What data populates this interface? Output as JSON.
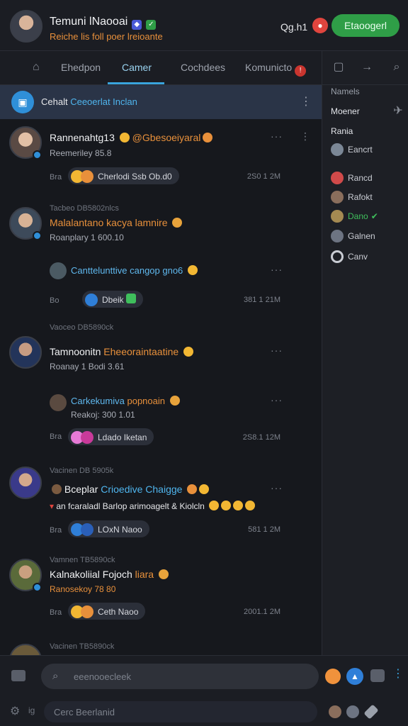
{
  "header": {
    "name": "Temuni lNaooai",
    "subtitle": "Reiche lis foll poer lreioante",
    "status": "Qg.h1",
    "cta_label": "Etaoogerl"
  },
  "tabs": [
    {
      "label": "Ehedpon"
    },
    {
      "label": "Camer"
    },
    {
      "label": "Cochdees"
    },
    {
      "label": "Komunicto"
    }
  ],
  "rail": {
    "items": [
      "Namels",
      "Moener",
      "Rania"
    ],
    "users": [
      "Eancrt",
      "Rancd",
      "Rafokt",
      "Dano",
      "Galnen",
      "Canv"
    ]
  },
  "pinned": {
    "text": "Cehalt",
    "highlight": "Ceeoerlat Inclan"
  },
  "posts": [
    {
      "meta": "",
      "title": "Rannenahtg13",
      "title_hl": "@Gbesoeiyaral",
      "sub": "Reemeriley 85.8",
      "footer": "Bra",
      "pill": "Cherlodi Ssb Ob.d0",
      "time": "2S0 1 2M"
    },
    {
      "meta": "Tacbeo DB5802nlcs",
      "title": "Malalantano kacya lamnire",
      "sub": "Roanplary 1 600.10",
      "nested": "Canttelunttive cangop gno6",
      "footer": "Bo",
      "pill": "Dbeik",
      "time": "381 1 21M"
    },
    {
      "meta": "Vaoceo DB5890ck",
      "title": "Tamnoonitn",
      "title_hl": "Eheeoraintaatine",
      "sub": "Roanay 1 Bodi 3.61",
      "nested": "Carkekumiva",
      "nested_hl": "popnoain",
      "nested_sub": "Reakoj: 300 1.01",
      "footer": "Bra",
      "pill": "Ldado Iketan",
      "time": "2S8.1 12M"
    },
    {
      "meta": "Vacinen DB 5905k",
      "title": "Bceplar",
      "title_hl": "Crioedive Chaigge",
      "sub": "an fcaraladl Barlop arimoagelt & Kiolcln",
      "footer": "Bra",
      "pill": "LOxN Naoo",
      "time": "581 1 2M"
    },
    {
      "meta": "Vamnen TB5890ck",
      "title": "Kalnakoliial Fojoch",
      "title_hl": "liara",
      "sub": "Ranosekoy 78 80",
      "footer": "Bra",
      "pill": "Ceth Naoo",
      "time": "2001.1 2M"
    },
    {
      "meta": "Vacinen TB5890ck"
    }
  ],
  "composer": {
    "placeholder": "eeenooecleek",
    "placeholder2": "Cerc Beerlanid",
    "lang": "ig"
  },
  "colors": {
    "accent": "#39a4dd",
    "cta": "#2f9e47",
    "highlight_orange": "#e8903b",
    "pinned_bg": "#2a3447"
  }
}
